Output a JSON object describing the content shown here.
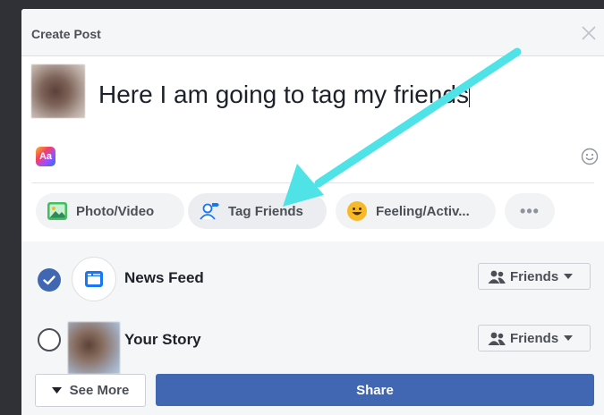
{
  "dialog": {
    "title": "Create Post",
    "close_icon": "close-icon"
  },
  "composer": {
    "post_text": "Here I am going to tag my friends",
    "text_format_badge": "Aa",
    "emoji_icon": "smiley-icon"
  },
  "actions": [
    {
      "label": "Photo/Video",
      "icon": "photo-video-icon",
      "color": "#45bd62"
    },
    {
      "label": "Tag Friends",
      "icon": "tag-friends-icon",
      "color": "#1877f2"
    },
    {
      "label": "Feeling/Activ...",
      "icon": "feeling-emoji-icon",
      "color": "#f7b928"
    },
    {
      "label": "•••",
      "icon": "more-dots-icon"
    }
  ],
  "audience": {
    "news_feed": {
      "label": "News Feed",
      "checked": true,
      "privacy": "Friends"
    },
    "your_story": {
      "label": "Your Story",
      "checked": false,
      "privacy": "Friends"
    }
  },
  "footer": {
    "see_more_label": "See More",
    "share_label": "Share"
  },
  "colors": {
    "brand_blue": "#4267b2",
    "annotation_arrow": "#4fe3e8"
  }
}
